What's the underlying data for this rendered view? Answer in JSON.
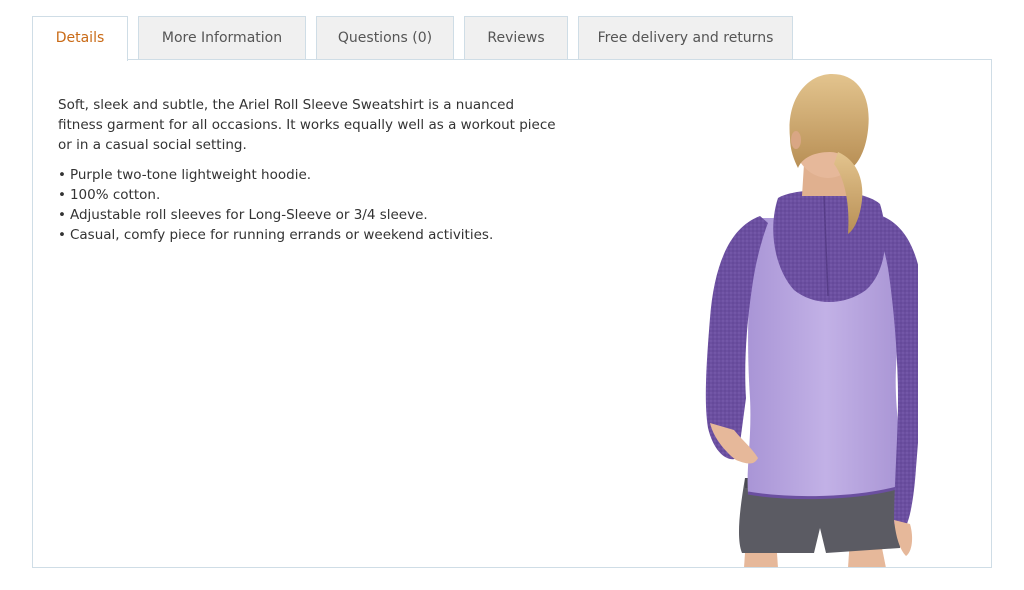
{
  "tabs": [
    {
      "label": "Details",
      "active": true
    },
    {
      "label": "More Information",
      "active": false
    },
    {
      "label": "Questions (0)",
      "active": false
    },
    {
      "label": "Reviews",
      "active": false
    },
    {
      "label": "Free delivery and returns",
      "active": false
    }
  ],
  "details": {
    "intro": "Soft, sleek and subtle, the Ariel Roll Sleeve Sweatshirt is a nuanced fitness garment for all occasions. It works equally well as a workout piece or in a casual social setting.",
    "features": [
      "Purple two-tone lightweight hoodie.",
      "100% cotton.",
      "Adjustable roll sleeves for Long-Sleeve or 3/4 sleeve.",
      "Casual, comfy piece for running errands or weekend activities."
    ]
  },
  "colors": {
    "active_tab_text": "#c96a16",
    "tab_border": "#cfdde6",
    "tab_background": "#f0f0f0",
    "hoodie_body": "#b9a6e0",
    "hoodie_sleeves": "#6b4fa0",
    "shorts": "#5b5b63",
    "hair": "#d6b37a"
  }
}
